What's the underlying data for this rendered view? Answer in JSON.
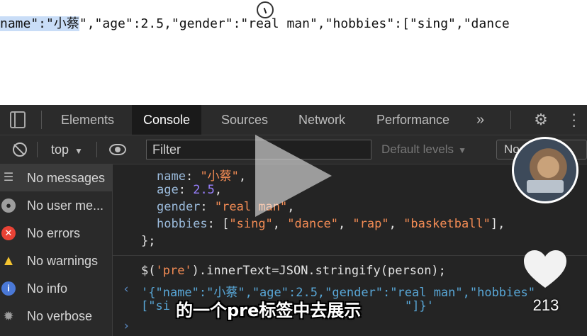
{
  "page": {
    "json_selected": "name\":\"小蔡",
    "json_rest": "\",\"age\":2.5,\"gender\":\"real man\",\"hobbies\":[\"sing\",\"dance"
  },
  "devtools": {
    "tabs": [
      "Elements",
      "Console",
      "Sources",
      "Network",
      "Performance"
    ],
    "more_tabs": "»",
    "toolbar": {
      "context": "top",
      "filter_placeholder": "Filter",
      "levels": "Default levels",
      "issues": "No Issues"
    },
    "sidebar": [
      {
        "icon": "list-icon",
        "label": "No messages"
      },
      {
        "icon": "user-icon",
        "label": "No user me..."
      },
      {
        "icon": "error-icon",
        "label": "No errors"
      },
      {
        "icon": "warning-icon",
        "label": "No warnings"
      },
      {
        "icon": "info-icon",
        "label": "No info"
      },
      {
        "icon": "verbose-icon",
        "label": "No verbose"
      }
    ],
    "console": {
      "obj_name_key": "name",
      "obj_name_val": "\"小蔡\"",
      "obj_age_key": "age",
      "obj_age_val": "2.5",
      "obj_gender_key": "gender",
      "obj_gender_val": "\"real man\"",
      "obj_hobbies_key": "hobbies",
      "hobby_1": "\"sing\"",
      "hobby_2": "\"dance\"",
      "hobby_3": "\"rap\"",
      "hobby_4": "\"basketball\"",
      "obj_close": "};",
      "cmd_prefix": "$(",
      "cmd_sel": "'pre'",
      "cmd_suffix": ").innerText=JSON.stringify(person);",
      "result_line1": "'{\"name\":\"小蔡\",\"age\":2.5,\"gender\":\"real man\",\"hobbies\"",
      "result_line2": "[\"si",
      "result_line2_end": "\"]}'"
    }
  },
  "overlay": {
    "likes": "213",
    "subtitle": "的一个pre标签中去展示"
  },
  "colors": {
    "devtools_bg": "#242424",
    "string": "#f28b54",
    "number": "#9980ff",
    "key": "#9bbbdc"
  }
}
